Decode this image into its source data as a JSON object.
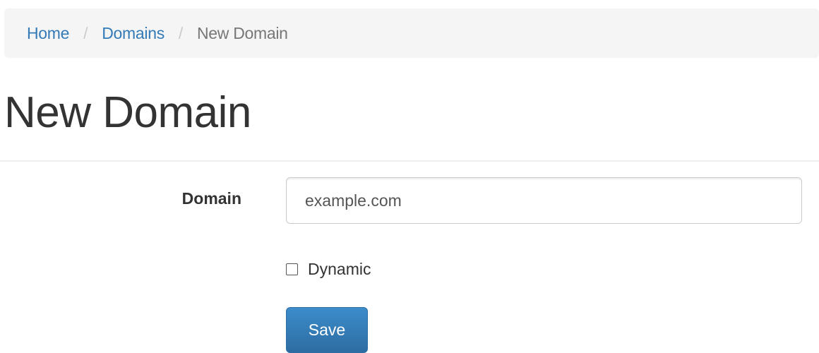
{
  "breadcrumb": {
    "items": [
      {
        "label": "Home"
      },
      {
        "label": "Domains"
      }
    ],
    "separator": "/",
    "active": "New Domain"
  },
  "page": {
    "title": "New Domain"
  },
  "form": {
    "domain_label": "Domain",
    "domain_value": "example.com",
    "dynamic_label": "Dynamic",
    "dynamic_checked": false,
    "save_label": "Save"
  },
  "colors": {
    "link": "#337ab7",
    "primary_button": "#337ab7",
    "breadcrumb_bg": "#f5f5f5"
  }
}
